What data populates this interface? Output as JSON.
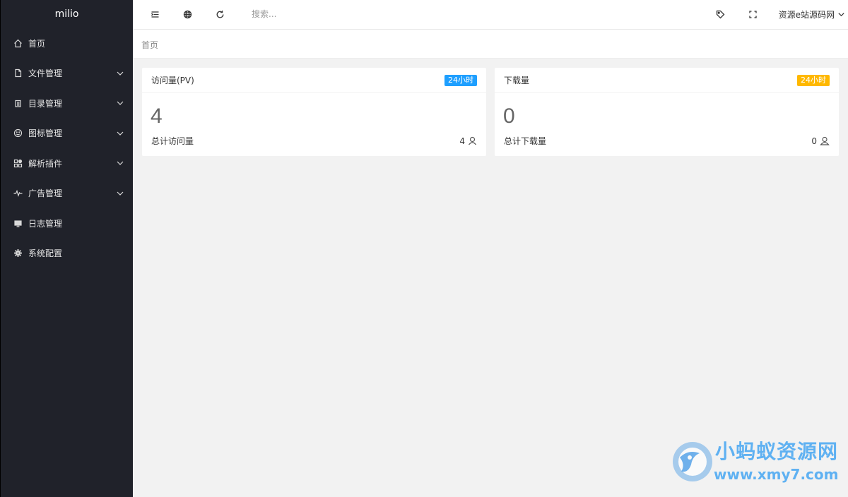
{
  "sidebar": {
    "logo": "milio",
    "items": [
      {
        "label": "首页",
        "icon": "home-icon",
        "has_submenu": false
      },
      {
        "label": "文件管理",
        "icon": "file-icon",
        "has_submenu": true
      },
      {
        "label": "目录管理",
        "icon": "list-icon",
        "has_submenu": true
      },
      {
        "label": "图标管理",
        "icon": "smile-icon",
        "has_submenu": true
      },
      {
        "label": "解析插件",
        "icon": "apps-icon",
        "has_submenu": true
      },
      {
        "label": "广告管理",
        "icon": "pulse-icon",
        "has_submenu": true
      },
      {
        "label": "日志管理",
        "icon": "monitor-icon",
        "has_submenu": false
      },
      {
        "label": "系统配置",
        "icon": "gear-icon",
        "has_submenu": false
      }
    ]
  },
  "header": {
    "search_placeholder": "搜索...",
    "user_name": "资源e站源码网",
    "icons": [
      "menu-toggle-icon",
      "globe-icon",
      "refresh-icon",
      "tag-icon",
      "fullscreen-icon"
    ]
  },
  "breadcrumb": {
    "current": "首页"
  },
  "cards": [
    {
      "title": "访问量(PV)",
      "badge": "24小时",
      "badge_color": "#1e9fff",
      "value": "4",
      "footer_label": "总计访问量",
      "footer_value": "4",
      "footer_icon": "user-icon"
    },
    {
      "title": "下载量",
      "badge": "24小时",
      "badge_color": "#ffb800",
      "value": "0",
      "footer_label": "总计下载量",
      "footer_value": "0",
      "footer_icon": "users-icon"
    }
  ],
  "watermark": {
    "line1": "小蚂蚁资源网",
    "line2": "www.xmy7.com"
  },
  "colors": {
    "sidebar_bg": "#20222a",
    "page_bg": "#f2f2f2",
    "accent_blue": "#1e9fff",
    "accent_orange": "#ffb800"
  }
}
